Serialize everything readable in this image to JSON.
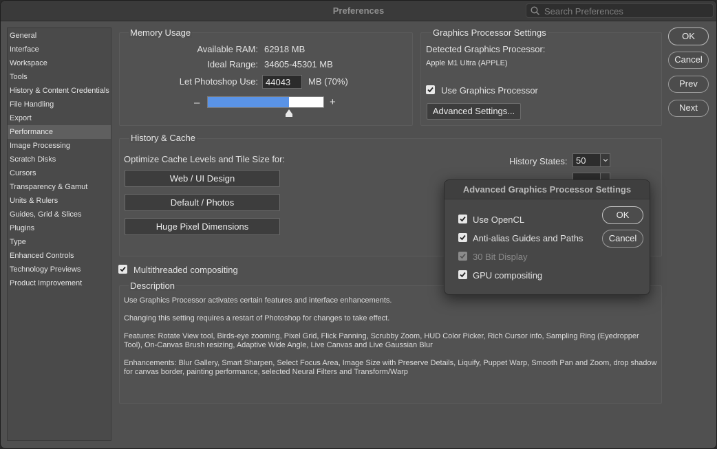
{
  "window": {
    "title": "Preferences"
  },
  "search": {
    "placeholder": "Search Preferences"
  },
  "sidebar": {
    "items": [
      {
        "label": "General"
      },
      {
        "label": "Interface"
      },
      {
        "label": "Workspace"
      },
      {
        "label": "Tools"
      },
      {
        "label": "History & Content Credentials"
      },
      {
        "label": "File Handling"
      },
      {
        "label": "Export"
      },
      {
        "label": "Performance",
        "active": true
      },
      {
        "label": "Image Processing"
      },
      {
        "label": "Scratch Disks"
      },
      {
        "label": "Cursors"
      },
      {
        "label": "Transparency & Gamut"
      },
      {
        "label": "Units & Rulers"
      },
      {
        "label": "Guides, Grid & Slices"
      },
      {
        "label": "Plugins"
      },
      {
        "label": "Type"
      },
      {
        "label": "Enhanced Controls"
      },
      {
        "label": "Technology Previews"
      },
      {
        "label": "Product Improvement"
      }
    ]
  },
  "memory": {
    "title": "Memory Usage",
    "available_label": "Available RAM:",
    "available_value": "62918 MB",
    "ideal_label": "Ideal Range:",
    "ideal_value": "34605-45301 MB",
    "use_label": "Let Photoshop Use:",
    "use_value": "44043",
    "use_suffix": "MB (70%)",
    "minus": "–",
    "plus": "+",
    "slider_fraction": 0.7
  },
  "gpu": {
    "title": "Graphics Processor Settings",
    "detected_label": "Detected Graphics Processor:",
    "detected_value": "Apple M1 Ultra (APPLE)",
    "use_gpu_label": "Use Graphics Processor",
    "use_gpu_checked": true,
    "advanced_button": "Advanced Settings..."
  },
  "history": {
    "title": "History & Cache",
    "optimize_label": "Optimize Cache Levels and Tile Size for:",
    "btn_web": "Web / UI Design",
    "btn_default": "Default / Photos",
    "btn_huge": "Huge Pixel Dimensions",
    "states_label": "History States:",
    "states_value": "50"
  },
  "multithreaded": {
    "label": "Multithreaded compositing",
    "checked": true
  },
  "description": {
    "title": "Description",
    "p1": "Use Graphics Processor activates certain features and interface enhancements.",
    "p2": "Changing this setting requires a restart of Photoshop for changes to take effect.",
    "p3": "Features: Rotate View tool, Birds-eye zooming, Pixel Grid, Flick Panning, Scrubby Zoom, HUD Color Picker, Rich Cursor info, Sampling Ring (Eyedropper Tool), On-Canvas Brush resizing, Adaptive Wide Angle, Live Canvas and Live Gaussian Blur",
    "p4": "Enhancements: Blur Gallery, Smart Sharpen, Select Focus Area, Image Size with Preserve Details, Liquify, Puppet Warp, Smooth Pan and Zoom, drop shadow for canvas border, painting performance, selected Neural Filters and Transform/Warp"
  },
  "dialog_buttons": {
    "ok": "OK",
    "cancel": "Cancel",
    "prev": "Prev",
    "next": "Next"
  },
  "popup": {
    "title": "Advanced Graphics Processor Settings",
    "opencl": "Use OpenCL",
    "antialias": "Anti-alias Guides and Paths",
    "bit30": "30 Bit Display",
    "gpu_compositing": "GPU compositing",
    "ok": "OK",
    "cancel": "Cancel"
  },
  "colors": {
    "accent": "#5a93e6",
    "window_bg": "#505050",
    "panel_bg": "#525252"
  }
}
